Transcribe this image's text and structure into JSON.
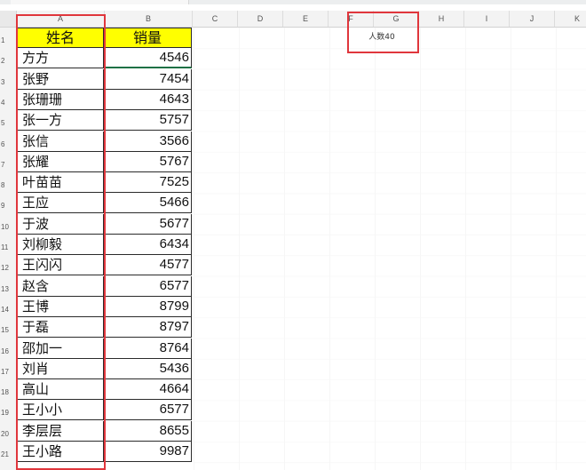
{
  "columns": [
    "A",
    "B",
    "C",
    "D",
    "E",
    "F",
    "G",
    "H",
    "I",
    "J",
    "K"
  ],
  "rows": [
    "1",
    "2",
    "3",
    "4",
    "5",
    "6",
    "7",
    "8",
    "9",
    "10",
    "11",
    "12",
    "13",
    "14",
    "15",
    "16",
    "17",
    "18",
    "19",
    "20",
    "21"
  ],
  "table": {
    "header_name": "姓名",
    "header_sales": "销量",
    "records": [
      {
        "name": "方方",
        "sales": "4546"
      },
      {
        "name": "张野",
        "sales": "7454"
      },
      {
        "name": "张珊珊",
        "sales": "4643"
      },
      {
        "name": "张一方",
        "sales": "5757"
      },
      {
        "name": "张信",
        "sales": "3566"
      },
      {
        "name": "张耀",
        "sales": "5767"
      },
      {
        "name": "叶苗苗",
        "sales": "7525"
      },
      {
        "name": "王应",
        "sales": "5466"
      },
      {
        "name": "于波",
        "sales": "5677"
      },
      {
        "name": "刘柳毅",
        "sales": "6434"
      },
      {
        "name": "王闪闪",
        "sales": "4577"
      },
      {
        "name": "赵含",
        "sales": "6577"
      },
      {
        "name": "王博",
        "sales": "8799"
      },
      {
        "name": "于磊",
        "sales": "8797"
      },
      {
        "name": "邵加一",
        "sales": "8764"
      },
      {
        "name": "刘肖",
        "sales": "5436"
      },
      {
        "name": "高山",
        "sales": "4664"
      },
      {
        "name": "王小小",
        "sales": "6577"
      },
      {
        "name": "李层层",
        "sales": "8655"
      },
      {
        "name": "王小路",
        "sales": "9987"
      }
    ]
  },
  "g1_label": "人数40",
  "colors": {
    "header_fill": "#ffff00",
    "highlight_border": "#e0363c",
    "selection_border": "#1e7145"
  }
}
